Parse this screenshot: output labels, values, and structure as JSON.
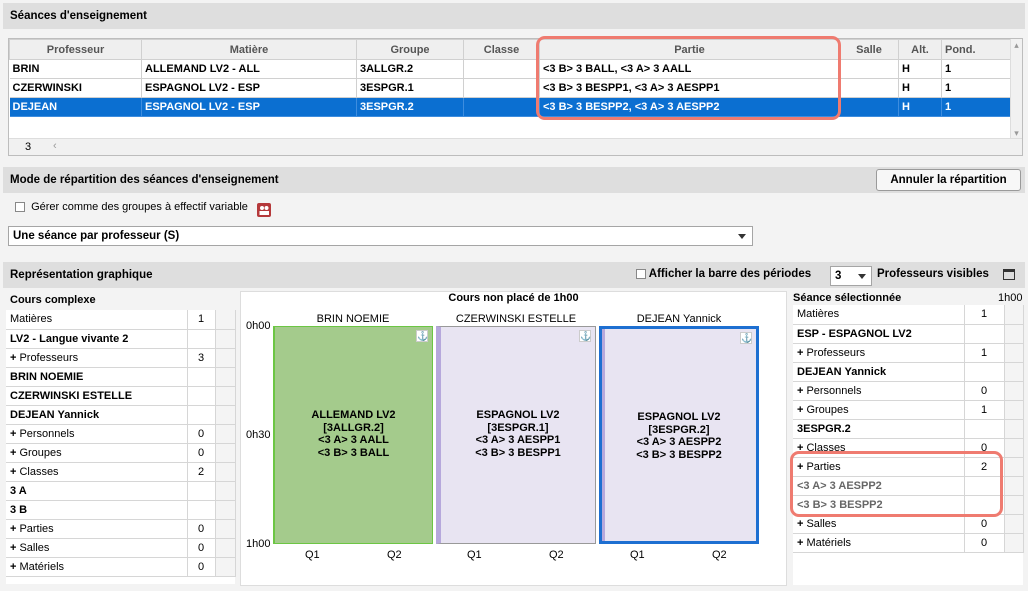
{
  "top": {
    "title": "Séances d'enseignement",
    "columns": [
      "Professeur",
      "Matière",
      "Groupe",
      "Classe",
      "Partie",
      "Salle",
      "Alt.",
      "Pond."
    ],
    "rows": [
      {
        "prof": "BRIN",
        "matiere": "ALLEMAND LV2 - ALL",
        "groupe": "3ALLGR.2",
        "classe": "",
        "partie": "<3 B> 3 BALL, <3 A> 3 AALL",
        "salle": "",
        "alt": "H",
        "pond": "1"
      },
      {
        "prof": "CZERWINSKI",
        "matiere": "ESPAGNOL LV2 - ESP",
        "groupe": "3ESPGR.1",
        "classe": "",
        "partie": "<3 B> 3 BESPP1, <3 A> 3 AESPP1",
        "salle": "",
        "alt": "H",
        "pond": "1"
      },
      {
        "prof": "DEJEAN",
        "matiere": "ESPAGNOL LV2 - ESP",
        "groupe": "3ESPGR.2",
        "classe": "",
        "partie": "<3 B> 3 BESPP2, <3 A> 3 AESPP2",
        "salle": "",
        "alt": "H",
        "pond": "1"
      }
    ],
    "count": "3"
  },
  "mode": {
    "title": "Mode de répartition des séances d'enseignement",
    "cancel_button": "Annuler la répartition",
    "checkbox_label": "Gérer comme des groupes à effectif variable",
    "select_value": "Une séance par professeur (S)"
  },
  "graph": {
    "title": "Représentation graphique",
    "periods_label": "Afficher la barre des périodes",
    "visible_count": "3",
    "visible_label": "Professeurs visibles"
  },
  "left": {
    "title": "Cours complexe",
    "rows": [
      {
        "label": "Matières",
        "value": "1",
        "plus": false,
        "style": "plain"
      },
      {
        "label": "LV2 - Langue vivante 2",
        "value": "",
        "plus": false,
        "style": "bold"
      },
      {
        "label": "Professeurs",
        "value": "3",
        "plus": true,
        "style": "plain"
      },
      {
        "label": "BRIN NOEMIE",
        "value": "",
        "plus": false,
        "style": "bold"
      },
      {
        "label": "CZERWINSKI ESTELLE",
        "value": "",
        "plus": false,
        "style": "bold"
      },
      {
        "label": "DEJEAN Yannick",
        "value": "",
        "plus": false,
        "style": "bold"
      },
      {
        "label": "Personnels",
        "value": "0",
        "plus": true,
        "style": "plain"
      },
      {
        "label": "Groupes",
        "value": "0",
        "plus": true,
        "style": "plain"
      },
      {
        "label": "Classes",
        "value": "2",
        "plus": true,
        "style": "plain"
      },
      {
        "label": "3 A",
        "value": "",
        "plus": false,
        "style": "bold"
      },
      {
        "label": "3 B",
        "value": "",
        "plus": false,
        "style": "bold"
      },
      {
        "label": "Parties",
        "value": "0",
        "plus": true,
        "style": "plain"
      },
      {
        "label": "Salles",
        "value": "0",
        "plus": true,
        "style": "plain"
      },
      {
        "label": "Matériels",
        "value": "0",
        "plus": true,
        "style": "plain"
      }
    ]
  },
  "center": {
    "title": "Cours non placé de 1h00",
    "times": [
      "0h00",
      "0h30",
      "1h00"
    ],
    "quarters": [
      "Q1",
      "Q2"
    ],
    "columns": [
      {
        "name": "BRIN NOEMIE",
        "lines": [
          "ALLEMAND LV2",
          "[3ALLGR.2]",
          "<3 A> 3 AALL",
          "<3 B> 3 BALL"
        ],
        "color": "#a4cb8c",
        "accent": "#6cc644"
      },
      {
        "name": "CZERWINSKI ESTELLE",
        "lines": [
          "ESPAGNOL LV2",
          "[3ESPGR.1]",
          "<3 A> 3 AESPP1",
          "<3 B> 3 BESPP1"
        ],
        "color": "#e8e4f2",
        "accent": "#b6a8dc"
      },
      {
        "name": "DEJEAN Yannick",
        "lines": [
          "ESPAGNOL LV2",
          "[3ESPGR.2]",
          "<3 A> 3 AESPP2",
          "<3 B> 3 BESPP2"
        ],
        "color": "#e8e4f2",
        "accent": "#1d6fd1"
      }
    ]
  },
  "right": {
    "title": "Séance sélectionnée",
    "duration": "1h00",
    "rows": [
      {
        "label": "Matières",
        "value": "1",
        "plus": false,
        "style": "plain"
      },
      {
        "label": "ESP - ESPAGNOL LV2",
        "value": "",
        "plus": false,
        "style": "bold"
      },
      {
        "label": "Professeurs",
        "value": "1",
        "plus": true,
        "style": "plain"
      },
      {
        "label": "DEJEAN Yannick",
        "value": "",
        "plus": false,
        "style": "bold"
      },
      {
        "label": "Personnels",
        "value": "0",
        "plus": true,
        "style": "plain"
      },
      {
        "label": "Groupes",
        "value": "1",
        "plus": true,
        "style": "plain"
      },
      {
        "label": "3ESPGR.2",
        "value": "",
        "plus": false,
        "style": "bold"
      },
      {
        "label": "Classes",
        "value": "0",
        "plus": true,
        "style": "plain"
      },
      {
        "label": "Parties",
        "value": "2",
        "plus": true,
        "style": "plain"
      },
      {
        "label": "<3 A> 3 AESPP2",
        "value": "",
        "plus": false,
        "style": "grey"
      },
      {
        "label": "<3 B> 3 BESPP2",
        "value": "",
        "plus": false,
        "style": "grey"
      },
      {
        "label": "Salles",
        "value": "0",
        "plus": true,
        "style": "plain"
      },
      {
        "label": "Matériels",
        "value": "0",
        "plus": true,
        "style": "plain"
      }
    ]
  },
  "colors": {
    "selection": "#0b6fd1",
    "highlight": "#ef7b70",
    "header": "#dedede"
  }
}
